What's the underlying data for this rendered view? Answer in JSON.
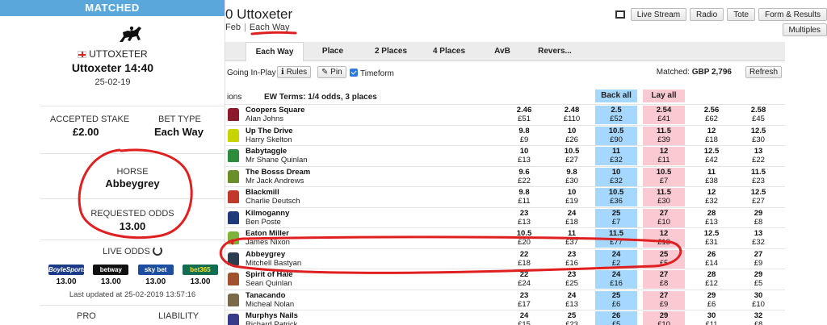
{
  "left": {
    "matched_label": "MATCHED",
    "course": "UTTOXETER",
    "race_title": "Uttoxeter 14:40",
    "race_date": "25-02-19",
    "stake_label": "ACCEPTED STAKE",
    "stake_value": "£2.00",
    "bet_type_label": "BET TYPE",
    "bet_type_value": "Each Way",
    "horse_label": "HORSE",
    "horse_value": "Abbeygrey",
    "requested_odds_label": "REQUESTED ODDS",
    "requested_odds_value": "13.00",
    "live_odds_label": "LIVE ODDS",
    "bookies": [
      {
        "logo": "BoyleSports",
        "odds": "13.00"
      },
      {
        "logo": "betway",
        "odds": "13.00"
      },
      {
        "logo": "sky bet",
        "odds": "13.00"
      },
      {
        "logo": "bet365",
        "odds": "13.00"
      }
    ],
    "updated": "Last updated at 25-02-2019 13:57:16",
    "pro_label": "PRO",
    "liability_label": "LIABILITY"
  },
  "header": {
    "title": "0 Uttoxeter",
    "month": "Feb",
    "each_way_link": "Each Way",
    "buttons": {
      "live_stream": "Live Stream",
      "radio": "Radio",
      "tote": "Tote",
      "form": "Form & Results",
      "multiples": "Multiples"
    }
  },
  "tabs": [
    "Each Way",
    "Place",
    "2 Places",
    "4 Places",
    "AvB",
    "Revers..."
  ],
  "options": {
    "going_in_play": "Going In-Play",
    "rules": "Rules",
    "pin": "Pin",
    "timeform": "Timeform",
    "matched_label": "Matched:",
    "matched_value": "GBP 2,796",
    "refresh": "Refresh"
  },
  "market": {
    "selections_label": "ions",
    "ew_terms": "EW Terms: 1/4 odds, 3 places",
    "back_all": "Back all",
    "lay_all": "Lay all"
  },
  "runners": [
    {
      "name": "Coopers Square",
      "jockey": "Alan Johns",
      "silk": "#8b1a2b",
      "prices": [
        [
          "2.46",
          "£51"
        ],
        [
          "2.48",
          "£110"
        ],
        [
          "2.5",
          "£52"
        ],
        [
          "2.54",
          "£41"
        ],
        [
          "2.56",
          "£62"
        ],
        [
          "2.58",
          "£45"
        ]
      ]
    },
    {
      "name": "Up The Drive",
      "jockey": "Harry Skelton",
      "silk": "#c8d400",
      "prices": [
        [
          "9.8",
          "£9"
        ],
        [
          "10",
          "£26"
        ],
        [
          "10.5",
          "£90"
        ],
        [
          "11.5",
          "£39"
        ],
        [
          "12",
          "£18"
        ],
        [
          "12.5",
          "£30"
        ]
      ]
    },
    {
      "name": "Babytaggle",
      "jockey": "Mr Shane Quinlan",
      "silk": "#2e8b3a",
      "prices": [
        [
          "10",
          "£13"
        ],
        [
          "10.5",
          "£27"
        ],
        [
          "11",
          "£32"
        ],
        [
          "12",
          "£11"
        ],
        [
          "12.5",
          "£42"
        ],
        [
          "13",
          "£22"
        ]
      ]
    },
    {
      "name": "The Bosss Dream",
      "jockey": "Mr Jack Andrews",
      "silk": "#6a8f2a",
      "prices": [
        [
          "9.6",
          "£22"
        ],
        [
          "9.8",
          "£30"
        ],
        [
          "10",
          "£32"
        ],
        [
          "10.5",
          "£7"
        ],
        [
          "11",
          "£38"
        ],
        [
          "11.5",
          "£23"
        ]
      ]
    },
    {
      "name": "Blackmill",
      "jockey": "Charlie Deutsch",
      "silk": "#c0392b",
      "prices": [
        [
          "9.8",
          "£11"
        ],
        [
          "10",
          "£19"
        ],
        [
          "10.5",
          "£36"
        ],
        [
          "11.5",
          "£30"
        ],
        [
          "12",
          "£32"
        ],
        [
          "12.5",
          "£27"
        ]
      ]
    },
    {
      "name": "Kilmoganny",
      "jockey": "Ben Poste",
      "silk": "#1f3a7a",
      "prices": [
        [
          "23",
          "£13"
        ],
        [
          "24",
          "£18"
        ],
        [
          "25",
          "£7"
        ],
        [
          "27",
          "£10"
        ],
        [
          "28",
          "£13"
        ],
        [
          "29",
          "£8"
        ]
      ]
    },
    {
      "name": "Eaton Miller",
      "jockey": "James Nixon",
      "silk": "#7cb33a",
      "prices": [
        [
          "10.5",
          "£20"
        ],
        [
          "11",
          "£37"
        ],
        [
          "11.5",
          "£77"
        ],
        [
          "12",
          "£13"
        ],
        [
          "12.5",
          "£31"
        ],
        [
          "13",
          "£32"
        ]
      ]
    },
    {
      "name": "Abbeygrey",
      "jockey": "Mitchell Bastyan",
      "silk": "#2b3d4f",
      "prices": [
        [
          "22",
          "£18"
        ],
        [
          "23",
          "£16"
        ],
        [
          "24",
          "£2"
        ],
        [
          "25",
          "£5"
        ],
        [
          "26",
          "£14"
        ],
        [
          "27",
          "£9"
        ]
      ]
    },
    {
      "name": "Spirit of Hale",
      "jockey": "Sean Quinlan",
      "silk": "#a0522d",
      "prices": [
        [
          "22",
          "£24"
        ],
        [
          "23",
          "£25"
        ],
        [
          "24",
          "£16"
        ],
        [
          "27",
          "£8"
        ],
        [
          "28",
          "£12"
        ],
        [
          "29",
          "£5"
        ]
      ]
    },
    {
      "name": "Tanacando",
      "jockey": "Micheal Nolan",
      "silk": "#7a6a4a",
      "prices": [
        [
          "23",
          "£17"
        ],
        [
          "24",
          "£13"
        ],
        [
          "25",
          "£6"
        ],
        [
          "27",
          "£9"
        ],
        [
          "29",
          "£6"
        ],
        [
          "30",
          "£10"
        ]
      ]
    },
    {
      "name": "Murphys Nails",
      "jockey": "Richard Patrick",
      "silk": "#3a3a8a",
      "prices": [
        [
          "24",
          "£15"
        ],
        [
          "25",
          "£23"
        ],
        [
          "26",
          "£5"
        ],
        [
          "29",
          "£10"
        ],
        [
          "30",
          "£11"
        ],
        [
          "32",
          "£8"
        ]
      ]
    }
  ],
  "colors": {
    "back": "#a6d8ff",
    "lay": "#fac9d1",
    "matched_bar": "#5aa7dc",
    "annotation": "#e02020"
  }
}
